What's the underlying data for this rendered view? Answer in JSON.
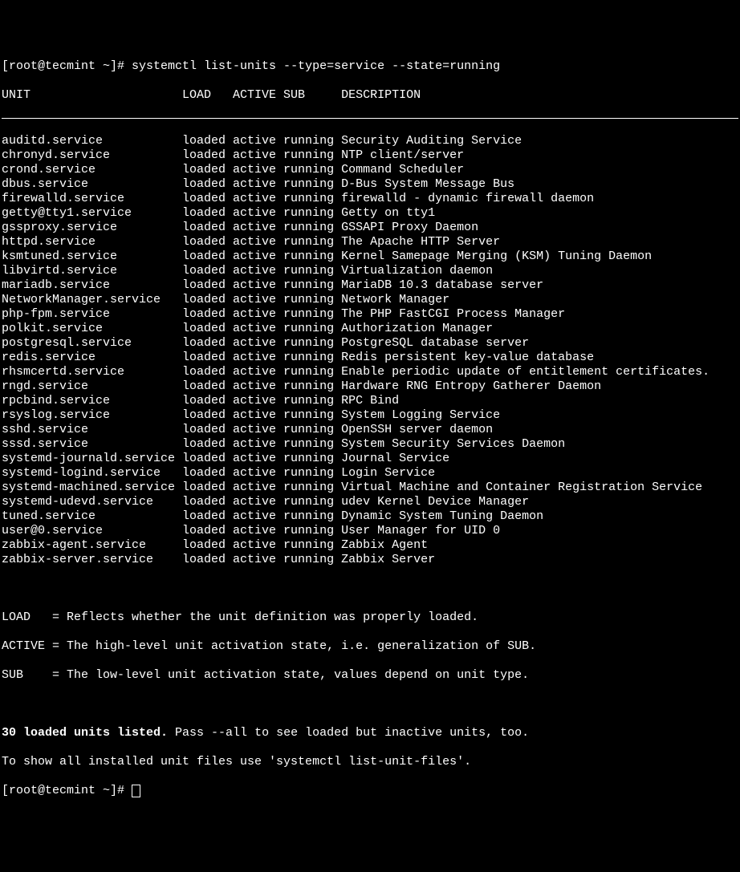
{
  "prompt1": "[root@tecmint ~]# ",
  "command": "systemctl list-units --type=service --state=running",
  "header": {
    "unit": "UNIT",
    "load": "LOAD",
    "active": "ACTIVE",
    "sub": "SUB",
    "desc": "DESCRIPTION"
  },
  "rows": [
    {
      "unit": "auditd.service",
      "load": "loaded",
      "active": "active",
      "sub": "running",
      "desc": "Security Auditing Service"
    },
    {
      "unit": "chronyd.service",
      "load": "loaded",
      "active": "active",
      "sub": "running",
      "desc": "NTP client/server"
    },
    {
      "unit": "crond.service",
      "load": "loaded",
      "active": "active",
      "sub": "running",
      "desc": "Command Scheduler"
    },
    {
      "unit": "dbus.service",
      "load": "loaded",
      "active": "active",
      "sub": "running",
      "desc": "D-Bus System Message Bus"
    },
    {
      "unit": "firewalld.service",
      "load": "loaded",
      "active": "active",
      "sub": "running",
      "desc": "firewalld - dynamic firewall daemon"
    },
    {
      "unit": "getty@tty1.service",
      "load": "loaded",
      "active": "active",
      "sub": "running",
      "desc": "Getty on tty1"
    },
    {
      "unit": "gssproxy.service",
      "load": "loaded",
      "active": "active",
      "sub": "running",
      "desc": "GSSAPI Proxy Daemon"
    },
    {
      "unit": "httpd.service",
      "load": "loaded",
      "active": "active",
      "sub": "running",
      "desc": "The Apache HTTP Server"
    },
    {
      "unit": "ksmtuned.service",
      "load": "loaded",
      "active": "active",
      "sub": "running",
      "desc": "Kernel Samepage Merging (KSM) Tuning Daemon"
    },
    {
      "unit": "libvirtd.service",
      "load": "loaded",
      "active": "active",
      "sub": "running",
      "desc": "Virtualization daemon"
    },
    {
      "unit": "mariadb.service",
      "load": "loaded",
      "active": "active",
      "sub": "running",
      "desc": "MariaDB 10.3 database server"
    },
    {
      "unit": "NetworkManager.service",
      "load": "loaded",
      "active": "active",
      "sub": "running",
      "desc": "Network Manager"
    },
    {
      "unit": "php-fpm.service",
      "load": "loaded",
      "active": "active",
      "sub": "running",
      "desc": "The PHP FastCGI Process Manager"
    },
    {
      "unit": "polkit.service",
      "load": "loaded",
      "active": "active",
      "sub": "running",
      "desc": "Authorization Manager"
    },
    {
      "unit": "postgresql.service",
      "load": "loaded",
      "active": "active",
      "sub": "running",
      "desc": "PostgreSQL database server"
    },
    {
      "unit": "redis.service",
      "load": "loaded",
      "active": "active",
      "sub": "running",
      "desc": "Redis persistent key-value database"
    },
    {
      "unit": "rhsmcertd.service",
      "load": "loaded",
      "active": "active",
      "sub": "running",
      "desc": "Enable periodic update of entitlement certificates."
    },
    {
      "unit": "rngd.service",
      "load": "loaded",
      "active": "active",
      "sub": "running",
      "desc": "Hardware RNG Entropy Gatherer Daemon"
    },
    {
      "unit": "rpcbind.service",
      "load": "loaded",
      "active": "active",
      "sub": "running",
      "desc": "RPC Bind"
    },
    {
      "unit": "rsyslog.service",
      "load": "loaded",
      "active": "active",
      "sub": "running",
      "desc": "System Logging Service"
    },
    {
      "unit": "sshd.service",
      "load": "loaded",
      "active": "active",
      "sub": "running",
      "desc": "OpenSSH server daemon"
    },
    {
      "unit": "sssd.service",
      "load": "loaded",
      "active": "active",
      "sub": "running",
      "desc": "System Security Services Daemon"
    },
    {
      "unit": "systemd-journald.service",
      "load": "loaded",
      "active": "active",
      "sub": "running",
      "desc": "Journal Service"
    },
    {
      "unit": "systemd-logind.service",
      "load": "loaded",
      "active": "active",
      "sub": "running",
      "desc": "Login Service"
    },
    {
      "unit": "systemd-machined.service",
      "load": "loaded",
      "active": "active",
      "sub": "running",
      "desc": "Virtual Machine and Container Registration Service"
    },
    {
      "unit": "systemd-udevd.service",
      "load": "loaded",
      "active": "active",
      "sub": "running",
      "desc": "udev Kernel Device Manager"
    },
    {
      "unit": "tuned.service",
      "load": "loaded",
      "active": "active",
      "sub": "running",
      "desc": "Dynamic System Tuning Daemon"
    },
    {
      "unit": "user@0.service",
      "load": "loaded",
      "active": "active",
      "sub": "running",
      "desc": "User Manager for UID 0"
    },
    {
      "unit": "zabbix-agent.service",
      "load": "loaded",
      "active": "active",
      "sub": "running",
      "desc": "Zabbix Agent"
    },
    {
      "unit": "zabbix-server.service",
      "load": "loaded",
      "active": "active",
      "sub": "running",
      "desc": "Zabbix Server"
    }
  ],
  "footer": {
    "load_line": "LOAD   = Reflects whether the unit definition was properly loaded.",
    "active_line": "ACTIVE = The high-level unit activation state, i.e. generalization of SUB.",
    "sub_line": "SUB    = The low-level unit activation state, values depend on unit type.",
    "count_bold": "30 loaded units listed.",
    "count_rest": " Pass --all to see loaded but inactive units, too.",
    "hint": "To show all installed unit files use 'systemctl list-unit-files'."
  },
  "prompt2": "[root@tecmint ~]# "
}
